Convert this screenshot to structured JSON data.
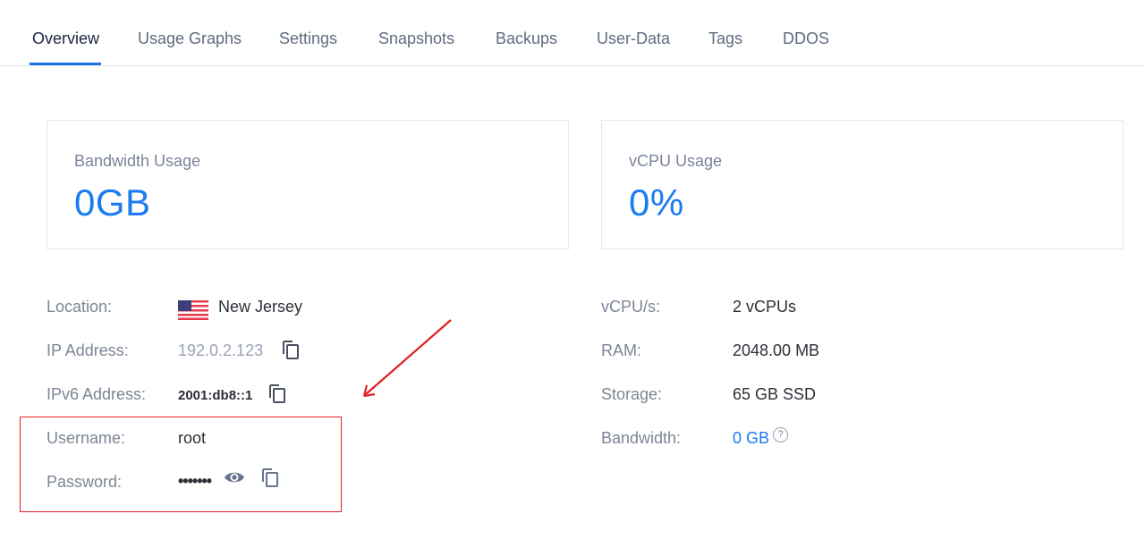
{
  "tabs": [
    {
      "label": "Overview",
      "active": true
    },
    {
      "label": "Usage Graphs",
      "active": false
    },
    {
      "label": "Settings",
      "active": false
    },
    {
      "label": "Snapshots",
      "active": false
    },
    {
      "label": "Backups",
      "active": false
    },
    {
      "label": "User-Data",
      "active": false
    },
    {
      "label": "Tags",
      "active": false
    },
    {
      "label": "DDOS",
      "active": false
    }
  ],
  "cards": {
    "bandwidth": {
      "title": "Bandwidth Usage",
      "value": "0GB"
    },
    "vcpu": {
      "title": "vCPU Usage",
      "value": "0%"
    }
  },
  "details_left": {
    "location": {
      "label": "Location:",
      "value": "New Jersey",
      "flag": "us-flag-icon"
    },
    "ip": {
      "label": "IP Address:",
      "value": "192.0.2.123"
    },
    "ipv6": {
      "label": "IPv6 Address:",
      "value": "2001:db8::1"
    },
    "username": {
      "label": "Username:",
      "value": "root"
    },
    "password": {
      "label": "Password:",
      "value": "•••••••"
    }
  },
  "details_right": {
    "vcpus": {
      "label": "vCPU/s:",
      "value": "2 vCPUs"
    },
    "ram": {
      "label": "RAM:",
      "value": "2048.00 MB"
    },
    "storage": {
      "label": "Storage:",
      "value": "65 GB SSD"
    },
    "bandwidth": {
      "label": "Bandwidth:",
      "value": "0 GB",
      "help": "?"
    }
  },
  "colors": {
    "accent": "#1a7cf0",
    "annotation": "#e02020"
  }
}
